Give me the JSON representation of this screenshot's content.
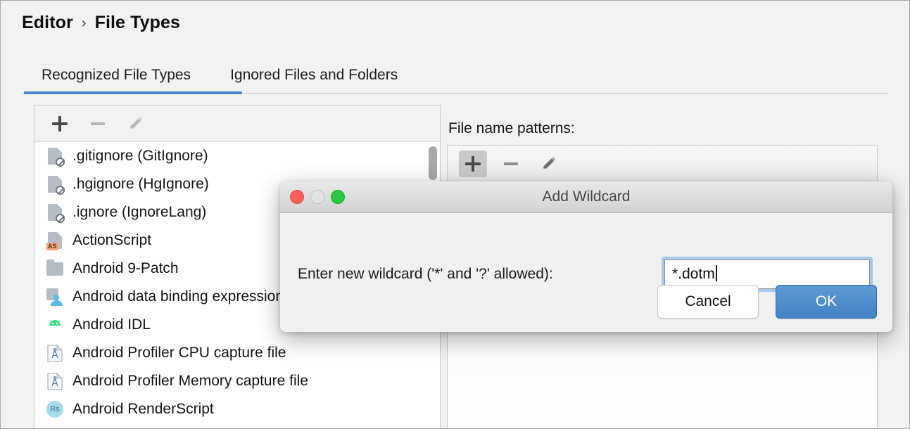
{
  "breadcrumb": {
    "root": "Editor",
    "separator": "›",
    "current": "File Types"
  },
  "tabs": [
    {
      "label": "Recognized File Types",
      "active": true
    },
    {
      "label": "Ignored Files and Folders",
      "active": false
    }
  ],
  "left_panel": {
    "toolbar": [
      {
        "name": "add-file-type-button",
        "icon": "plus-icon",
        "enabled": true
      },
      {
        "name": "remove-file-type-button",
        "icon": "minus-icon",
        "enabled": false
      },
      {
        "name": "edit-file-type-button",
        "icon": "pencil-icon",
        "enabled": false
      }
    ],
    "items": [
      {
        "label": ".gitignore (GitIgnore)",
        "icon": "ignore-file-icon"
      },
      {
        "label": ".hgignore (HgIgnore)",
        "icon": "ignore-file-icon"
      },
      {
        "label": ".ignore (IgnoreLang)",
        "icon": "ignore-file-icon"
      },
      {
        "label": "ActionScript",
        "icon": "actionscript-file-icon"
      },
      {
        "label": "Android 9-Patch",
        "icon": "folder-icon"
      },
      {
        "label": "Android data binding expressions",
        "icon": "android-data-binding-icon"
      },
      {
        "label": "Android IDL",
        "icon": "android-robot-icon"
      },
      {
        "label": "Android Profiler CPU capture file",
        "icon": "profiler-file-icon"
      },
      {
        "label": "Android Profiler Memory capture file",
        "icon": "profiler-file-icon"
      },
      {
        "label": "Android RenderScript",
        "icon": "renderscript-icon"
      }
    ]
  },
  "right_panel": {
    "label": "File name patterns:",
    "toolbar": [
      {
        "name": "add-pattern-button",
        "icon": "plus-icon",
        "pressed": true
      },
      {
        "name": "remove-pattern-button",
        "icon": "minus-icon",
        "pressed": false
      },
      {
        "name": "edit-pattern-button",
        "icon": "pencil-icon",
        "pressed": false
      }
    ],
    "patterns": []
  },
  "dialog": {
    "title": "Add Wildcard",
    "prompt": "Enter new wildcard ('*' and '?' allowed):",
    "input": {
      "value": "*.dotm",
      "placeholder": ""
    },
    "cancel_label": "Cancel",
    "ok_label": "OK"
  },
  "colors": {
    "accent": "#4a86c8",
    "ok_button": "#4382c4",
    "focus_ring": "#a6c8ec",
    "page_background": "#f2f2f2",
    "traffic_close": "#fc6058",
    "traffic_minimize": "#e2e2e2",
    "traffic_zoom": "#28c940"
  }
}
